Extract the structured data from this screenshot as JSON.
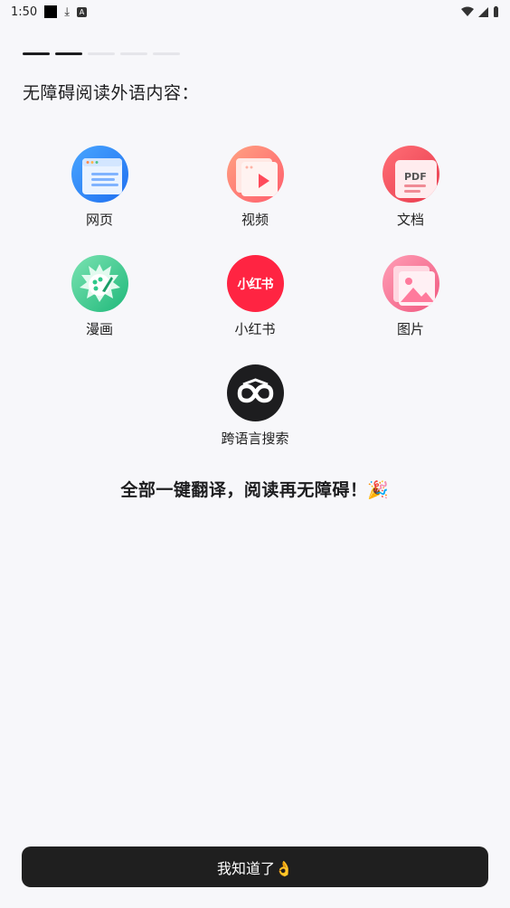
{
  "status_bar": {
    "time": "1:50"
  },
  "progress": {
    "total": 5,
    "current": 2
  },
  "heading": "无障碍阅读外语内容：",
  "items": [
    {
      "label": "网页",
      "icon": "webpage-icon",
      "color": "#2f7bf6"
    },
    {
      "label": "视频",
      "icon": "video-icon",
      "color": "#ff6a5a"
    },
    {
      "label": "文档",
      "icon": "pdf-document-icon",
      "color": "#ee4c5b",
      "badge": "PDF"
    },
    {
      "label": "漫画",
      "icon": "comic-palette-icon",
      "color": "#2ec98a"
    },
    {
      "label": "小红书",
      "icon": "xiaohongshu-logo-icon",
      "color": "#ff2442",
      "badge": "小红书"
    },
    {
      "label": "图片",
      "icon": "image-icon",
      "color": "#f56b8d"
    },
    {
      "label": "跨语言搜索",
      "icon": "cross-language-search-icon",
      "color": "#1d1d1f"
    }
  ],
  "tagline": "全部一键翻译，阅读再无障碍！🎉",
  "cta_label": "我知道了👌"
}
